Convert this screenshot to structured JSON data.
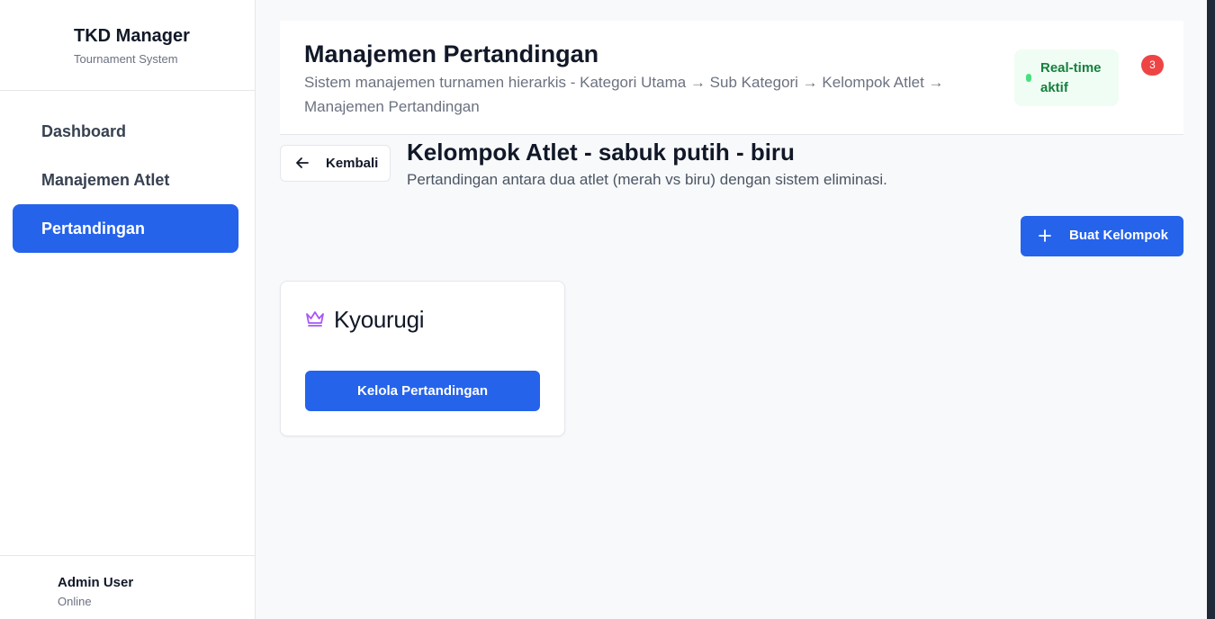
{
  "sidebar": {
    "brand_title": "TKD Manager",
    "brand_subtitle": "Tournament System",
    "items": [
      {
        "label": "Dashboard"
      },
      {
        "label": "Manajemen Atlet"
      },
      {
        "label": "Pertandingan",
        "active": true
      }
    ],
    "user": {
      "name": "Admin User",
      "status": "Online"
    }
  },
  "header": {
    "title": "Manajemen Pertandingan",
    "description": "Sistem manajemen turnamen hierarkis - Kategori Utama → Sub Kategori → Kelompok Atlet → Manajemen Pertandingan",
    "realtime_label": "Real-time aktif",
    "notification_count": "3"
  },
  "content": {
    "back_label": "Kembali",
    "group_title": "Kelompok Atlet - sabuk putih - biru",
    "group_description": "Pertandingan antara dua atlet (merah vs biru) dengan sistem eliminasi.",
    "create_label": "Buat Kelompok",
    "cards": [
      {
        "icon": "crown-icon",
        "title": "Kyourugi",
        "button_label": "Kelola Pertandingan"
      }
    ]
  },
  "colors": {
    "primary": "#2563eb",
    "crown": "#a855f7",
    "realtime_bg": "#f0fdf4",
    "realtime_text": "#15803d",
    "notification": "#ef4444"
  }
}
